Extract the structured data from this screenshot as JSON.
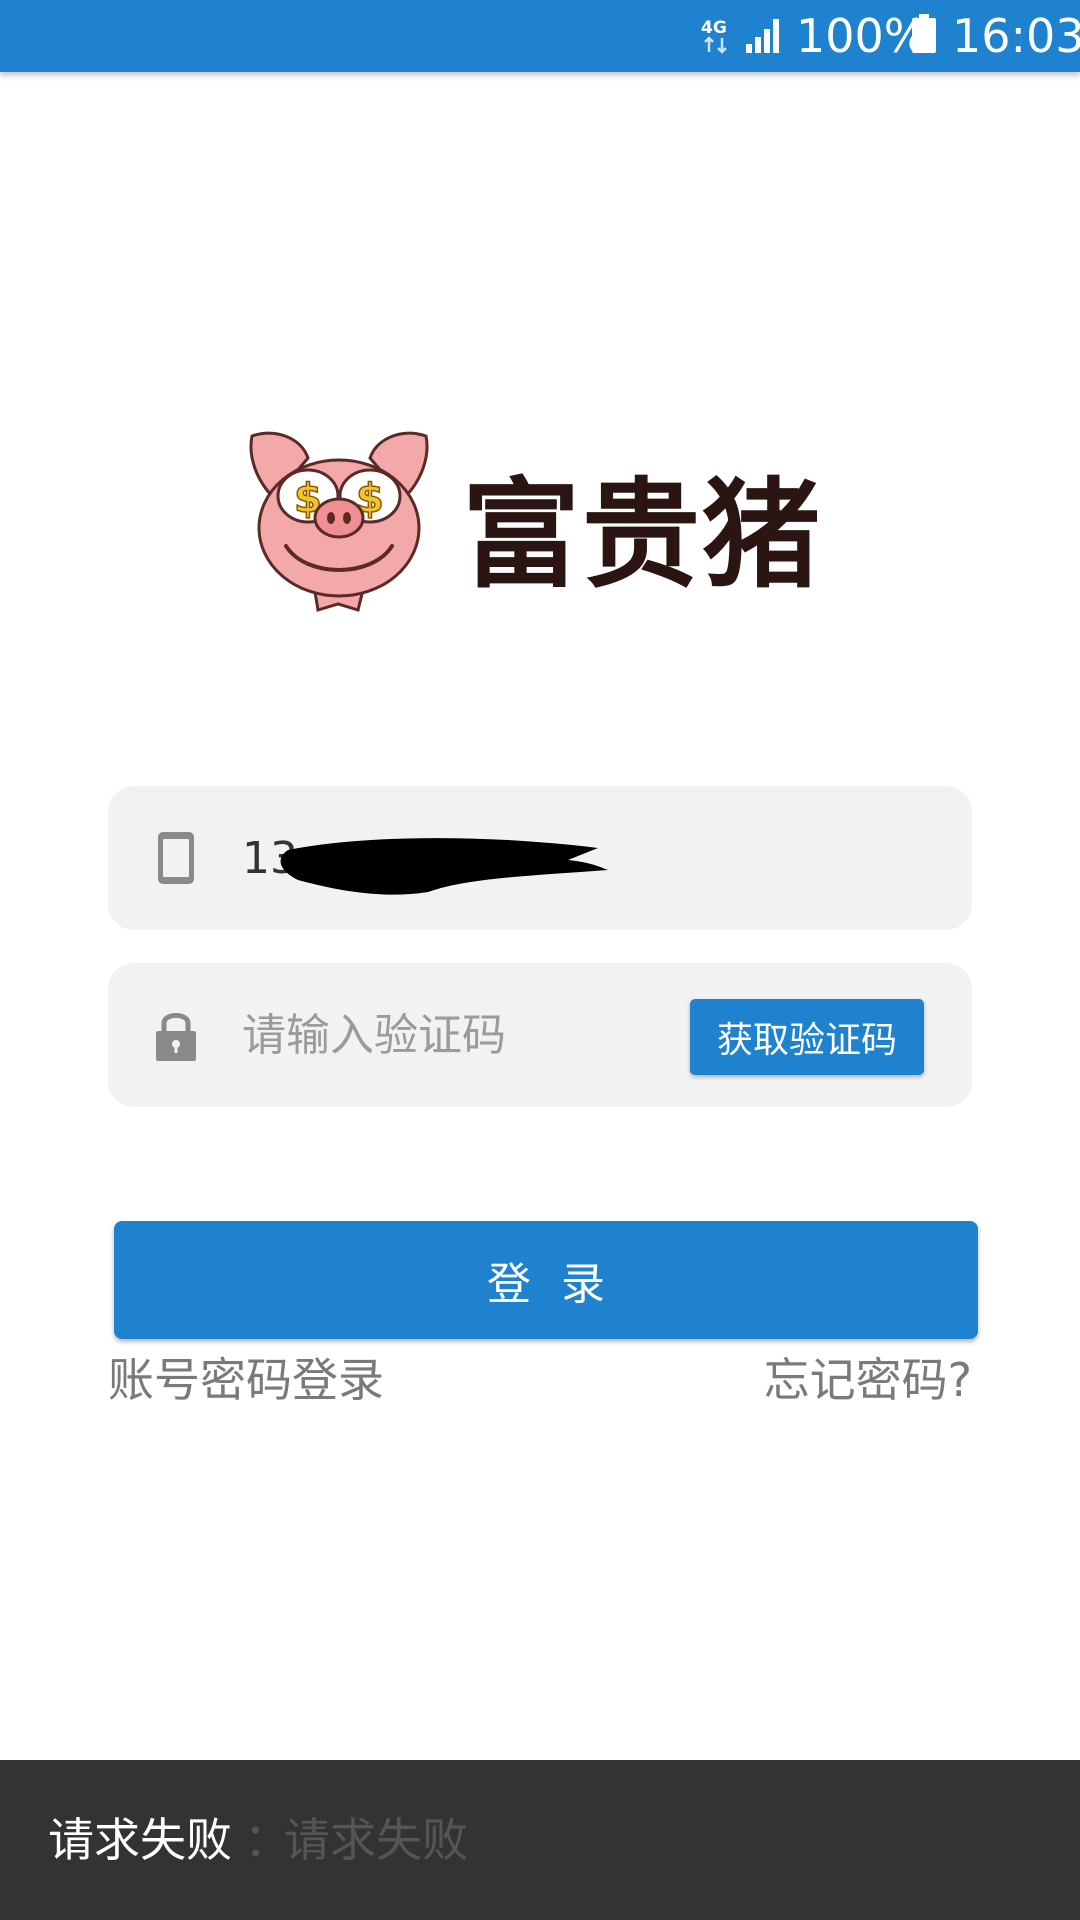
{
  "status_bar": {
    "network": "4G",
    "battery": "100%",
    "time": "16:03",
    "icons": [
      "network-4g-icon",
      "signal-icon",
      "battery-icon"
    ]
  },
  "logo": {
    "brand_name": "富贵猪",
    "mascot": "pig-mascot-icon",
    "colors": {
      "brand_text": "#2a1512",
      "pig": "#f3a9aa",
      "coin": "#f4c430"
    }
  },
  "form": {
    "phone": {
      "icon": "phone-icon",
      "value": "13"
    },
    "code": {
      "icon": "lock-icon",
      "placeholder": "请输入验证码",
      "button_label": "获取验证码"
    }
  },
  "login_button": {
    "label": "登录"
  },
  "links": {
    "account_login": "账号密码登录",
    "forgot_password": "忘记密码?"
  },
  "toast": {
    "title": "请求失败",
    "separator": "：",
    "message": "请求失败"
  },
  "colors": {
    "accent": "#1e82cf",
    "field_bg": "#f2f2f2",
    "toast_bg": "#333333"
  }
}
